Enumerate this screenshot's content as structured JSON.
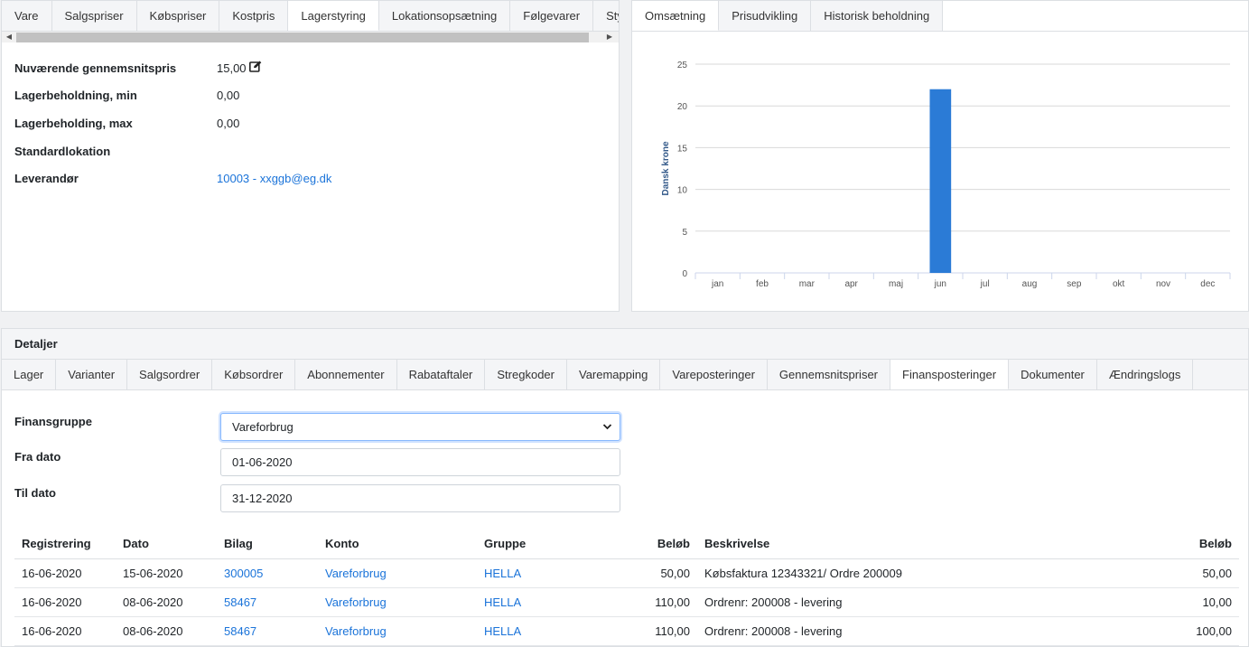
{
  "top_tabs": [
    "Vare",
    "Salgspriser",
    "Købspriser",
    "Kostpris",
    "Lagerstyring",
    "Lokationsopsætning",
    "Følgevarer",
    "Styklister"
  ],
  "top_active": "Lagerstyring",
  "fields": {
    "avg_price_label": "Nuværende gennemsnitspris",
    "avg_price_value": "15,00",
    "min_label": "Lagerbeholdning, min",
    "min_value": "0,00",
    "max_label": "Lagerbeholding, max",
    "max_value": "0,00",
    "location_label": "Standardlokation",
    "supplier_label": "Leverandør",
    "supplier_value": "10003 - xxggb@eg.dk"
  },
  "chart_tabs": [
    "Omsætning",
    "Prisudvikling",
    "Historisk beholdning"
  ],
  "chart_active": "Omsætning",
  "chart_data": {
    "type": "bar",
    "categories": [
      "jan",
      "feb",
      "mar",
      "apr",
      "maj",
      "jun",
      "jul",
      "aug",
      "sep",
      "okt",
      "nov",
      "dec"
    ],
    "values": [
      0,
      0,
      0,
      0,
      0,
      22,
      0,
      0,
      0,
      0,
      0,
      0
    ],
    "ylabel": "Dansk krone",
    "yticks": [
      0,
      5,
      10,
      15,
      20,
      25
    ],
    "ylim": [
      0,
      25
    ],
    "bar_color": "#2b7bd6",
    "grid": true
  },
  "details": {
    "title": "Detaljer",
    "tabs": [
      "Lager",
      "Varianter",
      "Salgsordrer",
      "Købsordrer",
      "Abonnementer",
      "Rabataftaler",
      "Stregkoder",
      "Varemapping",
      "Vareposteringer",
      "Gennemsnitspriser",
      "Finansposteringer",
      "Dokumenter",
      "Ændringslogs"
    ],
    "active_tab": "Finansposteringer",
    "filters": {
      "group_label": "Finansgruppe",
      "group_value": "Vareforbrug",
      "from_label": "Fra dato",
      "from_value": "01-06-2020",
      "to_label": "Til dato",
      "to_value": "31-12-2020"
    },
    "table": {
      "headers": [
        "Registrering",
        "Dato",
        "Bilag",
        "Konto",
        "Gruppe",
        "Beløb",
        "Beskrivelse",
        "Beløb"
      ],
      "rows": [
        [
          "16-06-2020",
          "15-06-2020",
          "300005",
          "Vareforbrug",
          "HELLA",
          "50,00",
          "Købsfaktura 12343321/ Ordre 200009",
          "50,00"
        ],
        [
          "16-06-2020",
          "08-06-2020",
          "58467",
          "Vareforbrug",
          "HELLA",
          "110,00",
          "Ordrenr: 200008 - levering",
          "10,00"
        ],
        [
          "16-06-2020",
          "08-06-2020",
          "58467",
          "Vareforbrug",
          "HELLA",
          "110,00",
          "Ordrenr: 200008 - levering",
          "100,00"
        ]
      ]
    }
  }
}
